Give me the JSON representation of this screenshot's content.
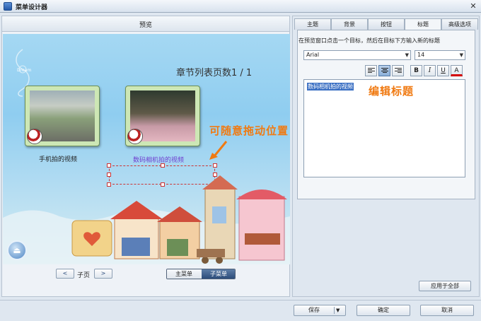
{
  "window": {
    "title": "菜单设计器",
    "close_glyph": "✕"
  },
  "preview": {
    "header": "预览",
    "chapter_counter": "章节列表页数1 / 1",
    "ghost_label": "Dream",
    "thumbnails": [
      {
        "caption": "手机拍的视频"
      },
      {
        "caption": "数码相机拍的视频"
      }
    ],
    "drag_annotation": "可随意拖动位置",
    "expand_glyph": "⏏"
  },
  "pager": {
    "prev_glyph": "<",
    "label": "子页",
    "next_glyph": ">",
    "menu_main": "主菜单",
    "menu_sub": "子菜单",
    "active_menu": "子菜单"
  },
  "tabs": {
    "items": [
      "主题",
      "背景",
      "按钮",
      "标题",
      "高级选项"
    ],
    "active": "标题"
  },
  "title_tab": {
    "instruction": "在预览窗口点击一个目标，然后在目标下方输入新的标题",
    "font_family": "Arial",
    "font_size": "14",
    "dropdown_glyph": "▼",
    "align_left_glyph": "≡",
    "align_center_glyph": "≡",
    "align_right_glyph": "≡",
    "active_align": "center",
    "bold_glyph": "B",
    "italic_glyph": "I",
    "underline_glyph": "U",
    "color_glyph": "A",
    "color_underline": "#d40000",
    "editor_text": "数码相机拍的视频",
    "editor_hint": "编辑标题",
    "apply_all": "应用于全部"
  },
  "footer": {
    "save": "保存",
    "ok": "确定",
    "cancel": "取消"
  },
  "colors": {
    "accent_orange": "#f07a12",
    "selection_blue": "#3a6fc3",
    "caption_purple": "#6f3fd0"
  }
}
